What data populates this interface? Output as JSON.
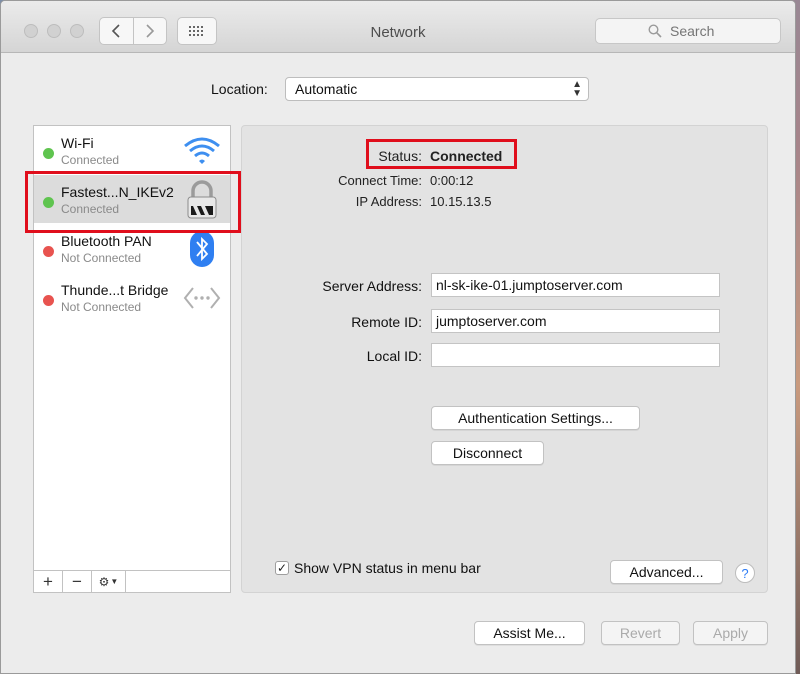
{
  "window": {
    "title": "Network",
    "search_placeholder": "Search"
  },
  "location": {
    "label": "Location:",
    "value": "Automatic"
  },
  "services": [
    {
      "name": "Wi-Fi",
      "status": "Connected",
      "status_color": "#5fc44f",
      "icon": "wifi-icon"
    },
    {
      "name": "Fastest...N_IKEv2",
      "status": "Connected",
      "status_color": "#5fc44f",
      "icon": "lock-icon"
    },
    {
      "name": "Bluetooth PAN",
      "status": "Not Connected",
      "status_color": "#e8534f",
      "icon": "bluetooth-icon"
    },
    {
      "name": "Thunde...t Bridge",
      "status": "Not Connected",
      "status_color": "#e8534f",
      "icon": "thunderbolt-bridge-icon"
    }
  ],
  "sidebar_controls": {
    "add": "+",
    "remove": "−"
  },
  "details": {
    "status_label": "Status:",
    "status_value": "Connected",
    "connect_time_label": "Connect Time:",
    "connect_time_value": "0:00:12",
    "ip_label": "IP Address:",
    "ip_value": "10.15.13.5",
    "server_label": "Server Address:",
    "server_value": "nl-sk-ike-01.jumptoserver.com",
    "remote_label": "Remote ID:",
    "remote_value": "jumptoserver.com",
    "local_label": "Local ID:",
    "local_value": "",
    "auth_button": "Authentication Settings...",
    "disconnect_button": "Disconnect",
    "show_vpn_label": "Show VPN status in menu bar",
    "show_vpn_checked": true,
    "advanced_button": "Advanced...",
    "help": "?"
  },
  "footer": {
    "assist": "Assist Me...",
    "revert": "Revert",
    "apply": "Apply"
  },
  "colors": {
    "highlight": "#e00e1c",
    "accent": "#2d7cf6"
  }
}
